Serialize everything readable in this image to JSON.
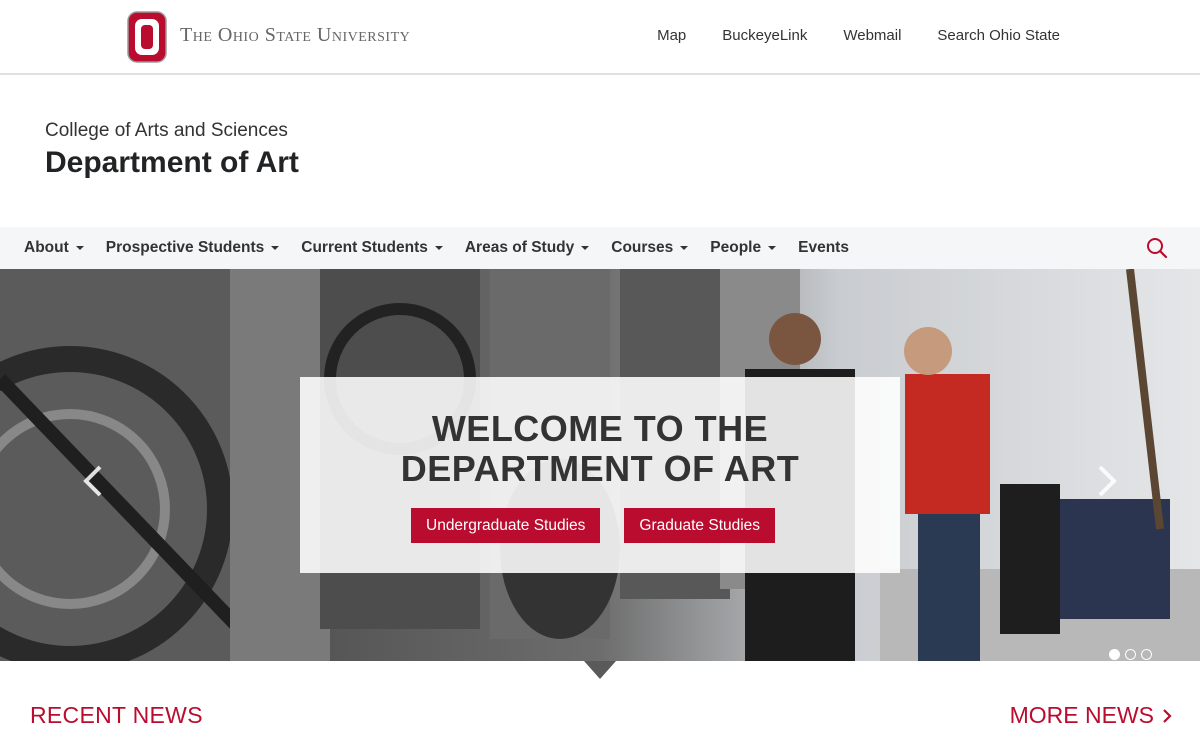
{
  "osu": {
    "wordmark": "The Ohio State University",
    "links": [
      "Map",
      "BuckeyeLink",
      "Webmail",
      "Search Ohio State"
    ],
    "brand_color": "#ba0c2f"
  },
  "site": {
    "college": "College of Arts and Sciences",
    "department": "Department of Art"
  },
  "nav": {
    "items": [
      {
        "label": "About",
        "dropdown": true
      },
      {
        "label": "Prospective Students",
        "dropdown": true
      },
      {
        "label": "Current Students",
        "dropdown": true
      },
      {
        "label": "Areas of Study",
        "dropdown": true
      },
      {
        "label": "Courses",
        "dropdown": true
      },
      {
        "label": "People",
        "dropdown": true
      },
      {
        "label": "Events",
        "dropdown": false
      }
    ],
    "search_icon": "search-icon"
  },
  "hero": {
    "title_line1": "WELCOME TO THE",
    "title_line2": "DEPARTMENT OF ART",
    "buttons": [
      "Undergraduate Studies",
      "Graduate Studies"
    ],
    "slide_count": 3,
    "active_slide": 1
  },
  "news": {
    "title": "RECENT NEWS",
    "more_label": "MORE NEWS"
  }
}
